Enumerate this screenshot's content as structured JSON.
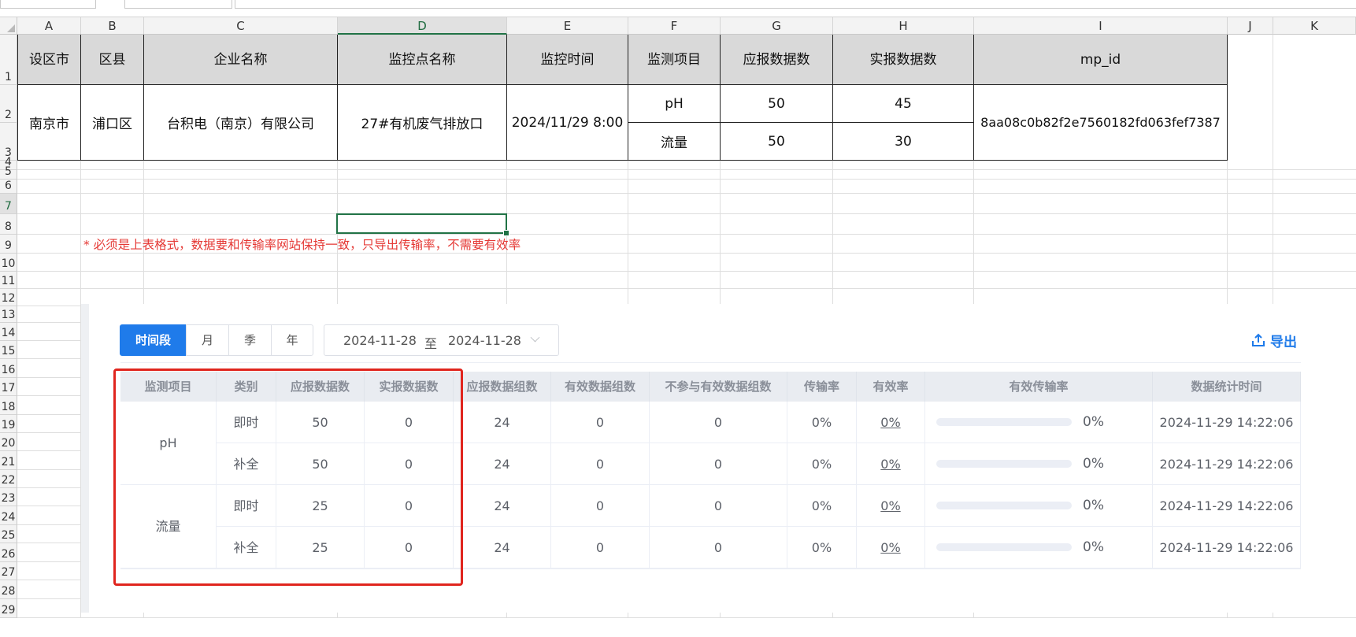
{
  "columns": [
    "A",
    "B",
    "C",
    "D",
    "E",
    "F",
    "G",
    "H",
    "I",
    "J",
    "K"
  ],
  "rows": [
    "1",
    "2",
    "3",
    "4",
    "5",
    "6",
    "7",
    "8",
    "9",
    "10",
    "11",
    "12",
    "13",
    "14",
    "15",
    "16",
    "17",
    "18",
    "19",
    "20",
    "21",
    "22",
    "23",
    "24",
    "25",
    "26",
    "27",
    "28",
    "29"
  ],
  "sheet": {
    "headers": [
      "设区市",
      "区县",
      "企业名称",
      "监控点名称",
      "监控时间",
      "监测项目",
      "应报数据数",
      "实报数据数",
      "mp_id"
    ],
    "city": "南京市",
    "district": "浦口区",
    "company": "台积电（南京）有限公司",
    "point": "27#有机废气排放口",
    "time": "2024/11/29 8:00",
    "items": [
      {
        "name": "pH",
        "expected": "50",
        "actual": "45"
      },
      {
        "name": "流量",
        "expected": "50",
        "actual": "30"
      }
    ],
    "mp_id": "8aa08c0b82f2e7560182fd063fef7387",
    "note": "* 必须是上表格式，数据要和传输率网站保持一致，只导出传输率，不需要有效率"
  },
  "web": {
    "tabs": [
      "时间段",
      "月",
      "季",
      "年"
    ],
    "active_tab": "时间段",
    "date_start": "2024-11-28",
    "date_sep": "至",
    "date_end": "2024-11-28",
    "export_label": "导出",
    "headers": [
      "监测项目",
      "类别",
      "应报数据数",
      "实报数据数",
      "应报数据组数",
      "有效数据组数",
      "不参与有效数据组数",
      "传输率",
      "有效率",
      "有效传输率",
      "数据统计时间"
    ],
    "groups": [
      {
        "item": "pH",
        "rows": [
          {
            "type": "即时",
            "expected": "50",
            "actual": "0",
            "exp_groups": "24",
            "valid_groups": "0",
            "excluded_groups": "0",
            "transfer_rate": "0%",
            "valid_rate": "0%",
            "valid_transfer_rate": "0%",
            "progress": 0,
            "stat_time": "2024-11-29 14:22:06"
          },
          {
            "type": "补全",
            "expected": "50",
            "actual": "0",
            "exp_groups": "24",
            "valid_groups": "0",
            "excluded_groups": "0",
            "transfer_rate": "0%",
            "valid_rate": "0%",
            "valid_transfer_rate": "0%",
            "progress": 0,
            "stat_time": "2024-11-29 14:22:06"
          }
        ]
      },
      {
        "item": "流量",
        "rows": [
          {
            "type": "即时",
            "expected": "25",
            "actual": "0",
            "exp_groups": "24",
            "valid_groups": "0",
            "excluded_groups": "0",
            "transfer_rate": "0%",
            "valid_rate": "0%",
            "valid_transfer_rate": "0%",
            "progress": 0,
            "stat_time": "2024-11-29 14:22:06"
          },
          {
            "type": "补全",
            "expected": "25",
            "actual": "0",
            "exp_groups": "24",
            "valid_groups": "0",
            "excluded_groups": "0",
            "transfer_rate": "0%",
            "valid_rate": "0%",
            "valid_transfer_rate": "0%",
            "progress": 0,
            "stat_time": "2024-11-29 14:22:06"
          }
        ]
      }
    ]
  },
  "colors": {
    "accent": "#1f7bea",
    "excel_green": "#217346",
    "highlight_red": "#e0251e",
    "note_red": "#e53935"
  }
}
